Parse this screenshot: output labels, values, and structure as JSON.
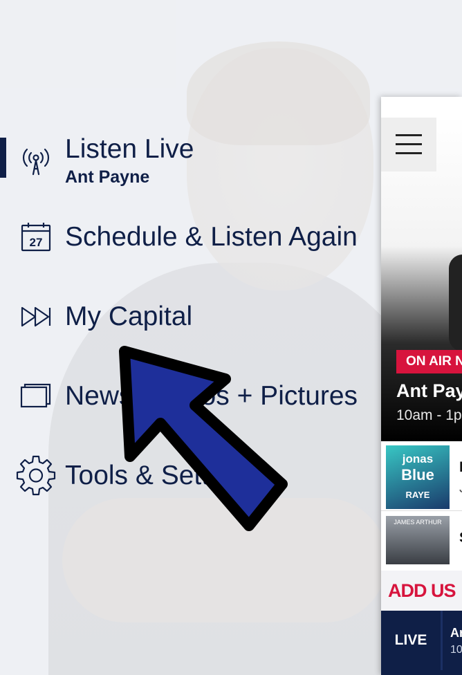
{
  "menu": {
    "items": [
      {
        "label": "Listen Live",
        "sublabel": "Ant Payne",
        "icon": "broadcast-icon",
        "active": true
      },
      {
        "label": "Schedule & Listen Again",
        "icon": "calendar-icon",
        "calendar_day": "27"
      },
      {
        "label": "My Capital",
        "icon": "fast-forward-icon"
      },
      {
        "label": "News, Videos + Pictures",
        "icon": "gallery-icon"
      },
      {
        "label": "Tools & Settings",
        "icon": "gear-icon"
      }
    ]
  },
  "panel": {
    "on_air_badge": "ON AIR N",
    "show_name": "Ant Pay",
    "show_time": "10am - 1p",
    "tracks": [
      {
        "title": "I",
        "subtitle": "J",
        "art_lines": [
          "jonas",
          "Blue",
          "RAYE"
        ]
      },
      {
        "title": "S",
        "art_lines": [
          "JAMES ARTHUR"
        ]
      }
    ],
    "banner_text": "ADD US",
    "live_label": "LIVE",
    "live_line1": "Ar",
    "live_line2": "10"
  },
  "colors": {
    "navy": "#0f1f47",
    "red": "#d7143d",
    "annotation_arrow": "#1e2f9a"
  }
}
